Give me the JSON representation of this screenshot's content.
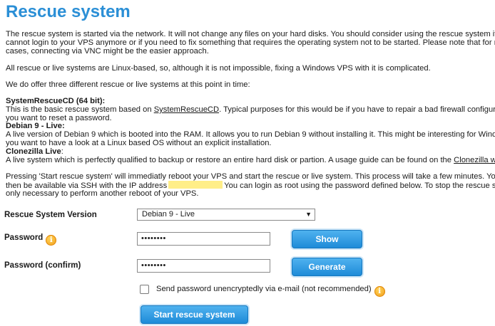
{
  "title": "Rescue system",
  "intro": [
    "The rescue system is started via the network. It will not change any files on your hard disks. You should consider using the rescue system if y",
    "cannot login to your VPS anymore or if you need to fix something that requires the operating system not to be started. Please note that for ma",
    "cases, connecting via VNC might be the easier approach."
  ],
  "linux_note": "All rescue or live systems are Linux-based, so, although it is not impossible, fixing a Windows VPS with it is complicated.",
  "offer_note": "We do offer three different rescue or live systems at this point in time:",
  "systems": {
    "src_title": "SystemRescueCD (64 bit):",
    "src_line1_a": "This is the basic rescue system based on ",
    "src_link": "SystemRescueCD",
    "src_line1_b": ". Typical purposes for this would be if you have to repair a bad firewall configurat",
    "src_line2": "you want to reset a password.",
    "deb_title": "Debian 9 - Live:",
    "deb_line1": "A live version of Debian 9 which is booted into the RAM. It allows you to run Debian 9 without installing it. This might be interesting for Window",
    "deb_line2": "you want to have a look at a Linux based OS without an explicit installation.",
    "clz_title": "Clonezilla Live",
    "clz_colon": ":",
    "clz_line1_a": "A live system which is perfectly qualified to backup or restore an entire hard disk or partion. A usage guide can be found on the ",
    "clz_link": "Clonezilla we"
  },
  "pressing": {
    "line1": "Pressing 'Start rescue system' will immediatly reboot your VPS and start the rescue or live system. This process will take a few minutes. Your",
    "line2_a": "then be available via SSH with the IP address",
    "line2_b": "You can login as root using the password defined below. To stop the rescue sys",
    "line3": "only necessary to perform another reboot of your VPS."
  },
  "form": {
    "version_label": "Rescue System Version",
    "version_value": "Debian 9 - Live",
    "password_label": "Password",
    "password_value": "••••••••",
    "confirm_label": "Password (confirm)",
    "confirm_value": "••••••••",
    "show_button": "Show",
    "generate_button": "Generate",
    "email_checkbox_label": "Send password unencryptedly via e-mail (not recommended)",
    "start_button": "Start rescue system"
  }
}
